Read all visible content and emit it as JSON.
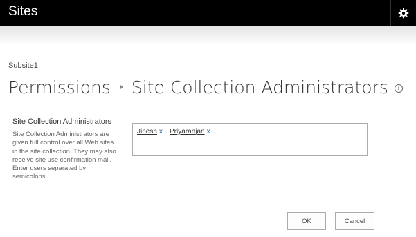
{
  "app": {
    "title": "Sites"
  },
  "icons": {
    "settings": "gear-icon",
    "info": "info-icon"
  },
  "breadcrumb": "Subsite1",
  "heading": {
    "part1": "Permissions",
    "part2": "Site Collection Administrators",
    "info_glyph": "i"
  },
  "section": {
    "title": "Site Collection Administrators",
    "description": "Site Collection Administrators are given full control over all Web sites in the site collection. They may also receive site use confirmation mail. Enter users separated by semicolons."
  },
  "people_picker": {
    "entries": [
      {
        "name": "Jinesh",
        "remove": "x"
      },
      {
        "name": "Priyaranjan",
        "remove": "x"
      }
    ]
  },
  "buttons": {
    "ok": "OK",
    "cancel": "Cancel"
  },
  "colors": {
    "topbar": "#000000",
    "link": "#2a5fa0"
  }
}
